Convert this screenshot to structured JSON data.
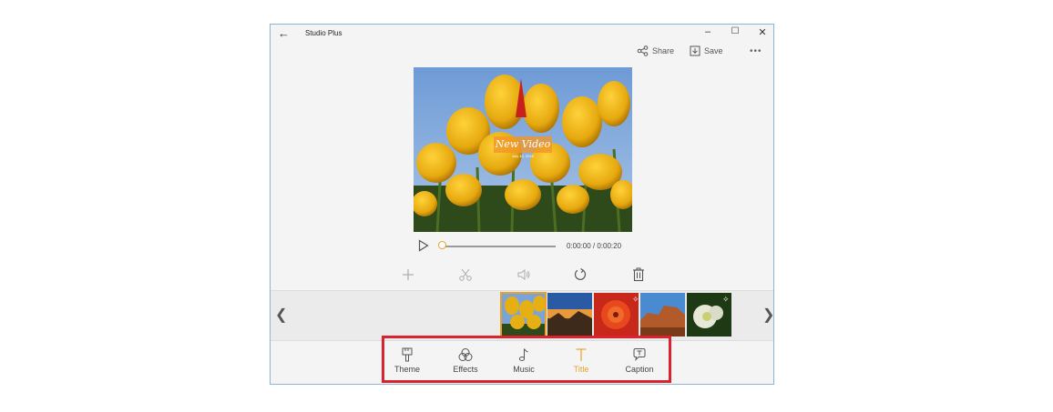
{
  "window": {
    "title": "Studio Plus",
    "back_glyph": "←",
    "minimize_glyph": "–",
    "maximize_glyph": "☐",
    "close_glyph": "✕"
  },
  "commands": {
    "share_label": "Share",
    "save_label": "Save",
    "more_glyph": "•••"
  },
  "preview": {
    "title_text": "New Video",
    "subtitle_text": "July 10, 2015"
  },
  "playback": {
    "time": "0:00:00 / 0:00:20",
    "progress": 0
  },
  "timeline": {
    "prev_glyph": "❮",
    "next_glyph": "❯"
  },
  "tabs": [
    {
      "label": "Theme",
      "icon": "theme-icon"
    },
    {
      "label": "Effects",
      "icon": "effects-icon"
    },
    {
      "label": "Music",
      "icon": "music-icon"
    },
    {
      "label": "Title",
      "icon": "title-icon",
      "active": true
    },
    {
      "label": "Caption",
      "icon": "caption-icon"
    }
  ],
  "colors": {
    "accent": "#e8a22a",
    "highlight_box": "#d9232e",
    "window_border": "#8cb4d8"
  }
}
